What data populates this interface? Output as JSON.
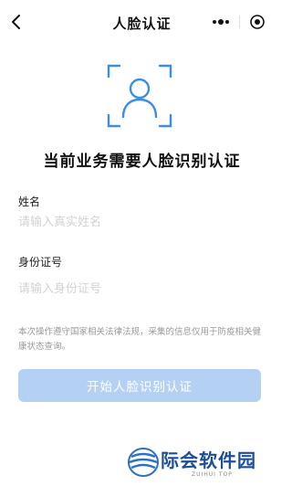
{
  "header": {
    "title": "人脸认证",
    "back_icon": "chevron-left-icon",
    "more_icon": "more-dots-icon",
    "close_icon": "target-circle-icon"
  },
  "main": {
    "heading": "当前业务需要人脸识别认证",
    "name_field": {
      "label": "姓名",
      "placeholder": "请输入真实姓名",
      "value": ""
    },
    "id_field": {
      "label": "身份证号",
      "placeholder": "请输入身份证号",
      "value": ""
    },
    "notice": "本次操作遵守国家相关法律法规，采集的信息仅用于防疫相关健康状态查询。",
    "start_button": "开始人脸识别认证"
  },
  "watermark": {
    "text": "际会软件园",
    "sub": "ZUIHUI TOP"
  },
  "colors": {
    "accent_face": "#3a8ee6",
    "button_disabled": "#b4d1f4",
    "watermark": "#1e4f96"
  }
}
